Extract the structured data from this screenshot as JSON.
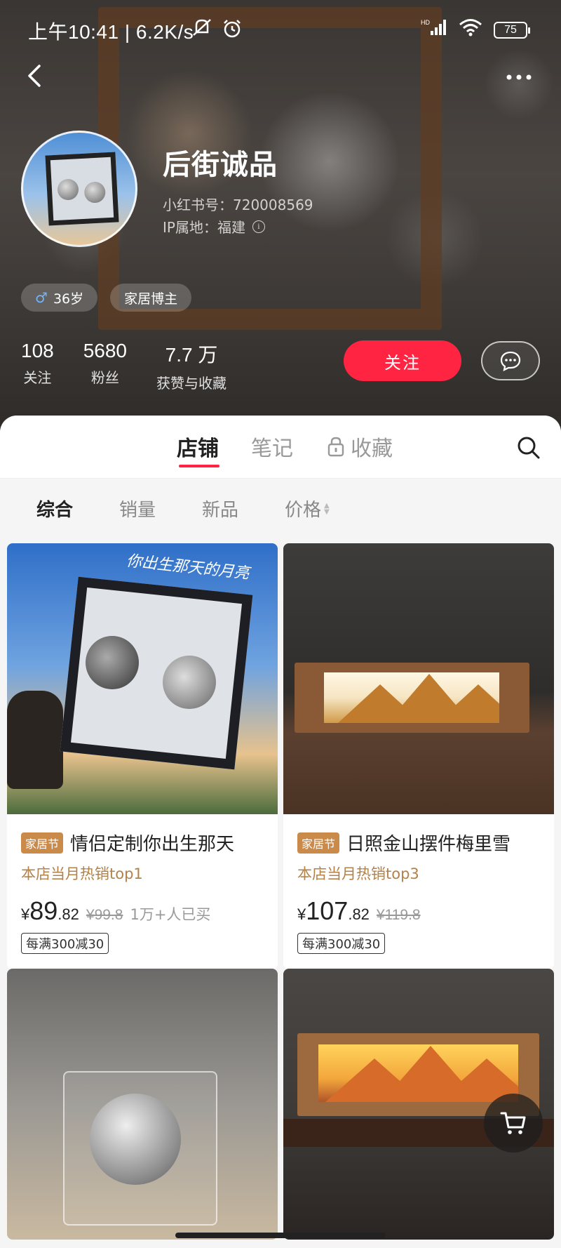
{
  "status_bar": {
    "time": "上午10:41 | 6.2K/s",
    "battery": "75",
    "net_label": "HD"
  },
  "profile": {
    "name": "后街诚品",
    "id": "小红书号：720008569",
    "ip": "IP属地：福建",
    "tags": [
      {
        "label": "36岁",
        "icon": "male-icon"
      },
      {
        "label": "家居博主"
      }
    ],
    "stats": [
      {
        "value": "108",
        "label": "关注"
      },
      {
        "value": "5680",
        "label": "粉丝"
      },
      {
        "value": "7.7 万",
        "label": "获赞与收藏"
      }
    ],
    "follow_label": "关注"
  },
  "tabs": [
    {
      "label": "店铺",
      "active": true
    },
    {
      "label": "笔记",
      "active": false
    },
    {
      "label": "收藏",
      "active": false,
      "icon": "lock-icon"
    }
  ],
  "filters": [
    {
      "label": "综合",
      "active": true
    },
    {
      "label": "销量",
      "active": false
    },
    {
      "label": "新品",
      "active": false
    },
    {
      "label": "价格",
      "active": false,
      "icon": "sort-arrows-icon"
    }
  ],
  "products": [
    {
      "badge": "家居节",
      "title": "情侣定制你出生那天",
      "hot": "本店当月热销top1",
      "price_yen": "¥",
      "price_int": "89",
      "price_dec": ".82",
      "orig_price": "¥99.8",
      "sold": "1万+人已买",
      "coupon": "每满300减30",
      "image_text": "你出生那天的月亮"
    },
    {
      "badge": "家居节",
      "title": "日照金山摆件梅里雪",
      "hot": "本店当月热销top3",
      "price_yen": "¥",
      "price_int": "107",
      "price_dec": ".82",
      "orig_price": "¥119.8",
      "sold": "",
      "coupon": "每满300减30"
    },
    {
      "title": ""
    },
    {
      "title": ""
    }
  ],
  "colors": {
    "accent": "#ff2442",
    "badge": "#c98a4a",
    "hot_text": "#b48248"
  }
}
